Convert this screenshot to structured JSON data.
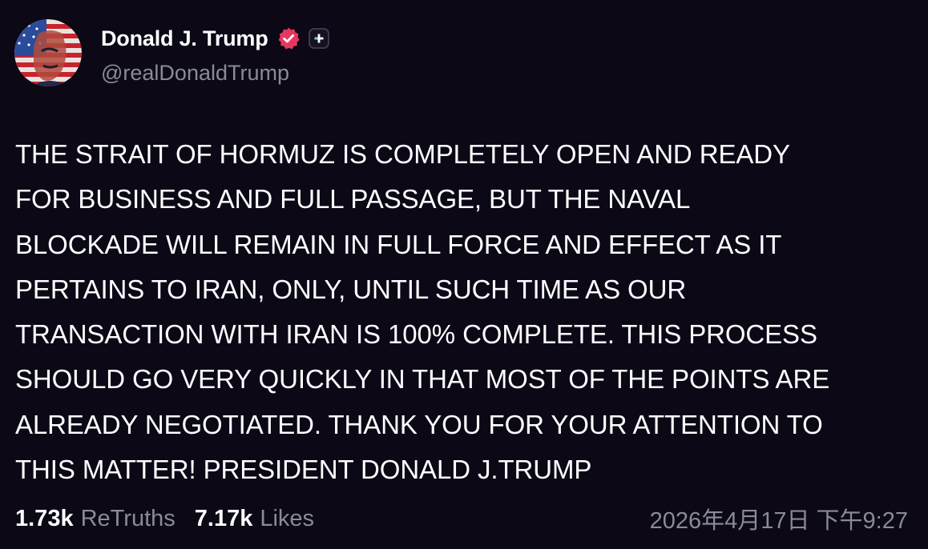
{
  "author": {
    "display_name": "Donald J. Trump",
    "handle": "@realDonaldTrump",
    "verified_badge_color": "#e5385f",
    "avatar_icon": "flag-portrait-avatar",
    "verified_icon": "verified-badge-icon",
    "plus_icon": "plus-badge-icon"
  },
  "post": {
    "lines": [
      "THE STRAIT OF HORMUZ IS COMPLETELY OPEN AND READY",
      "FOR BUSINESS AND FULL PASSAGE, BUT THE NAVAL",
      "BLOCKADE WILL REMAIN IN FULL FORCE AND EFFECT AS IT",
      "PERTAINS TO IRAN, ONLY, UNTIL SUCH TIME AS OUR",
      "TRANSACTION WITH IRAN IS 100% COMPLETE. THIS PROCESS",
      "SHOULD GO VERY QUICKLY IN THAT MOST OF THE POINTS ARE",
      "ALREADY NEGOTIATED. THANK YOU FOR YOUR ATTENTION TO",
      "THIS MATTER! PRESIDENT DONALD J.TRUMP"
    ]
  },
  "stats": {
    "retruths_count": "1.73k",
    "retruths_label": "ReTruths",
    "likes_count": "7.17k",
    "likes_label": "Likes"
  },
  "timestamp": "2026年4月17日 下午9:27",
  "colors": {
    "background": "#0c0816",
    "text": "#ffffff",
    "muted": "#8b8a97"
  }
}
